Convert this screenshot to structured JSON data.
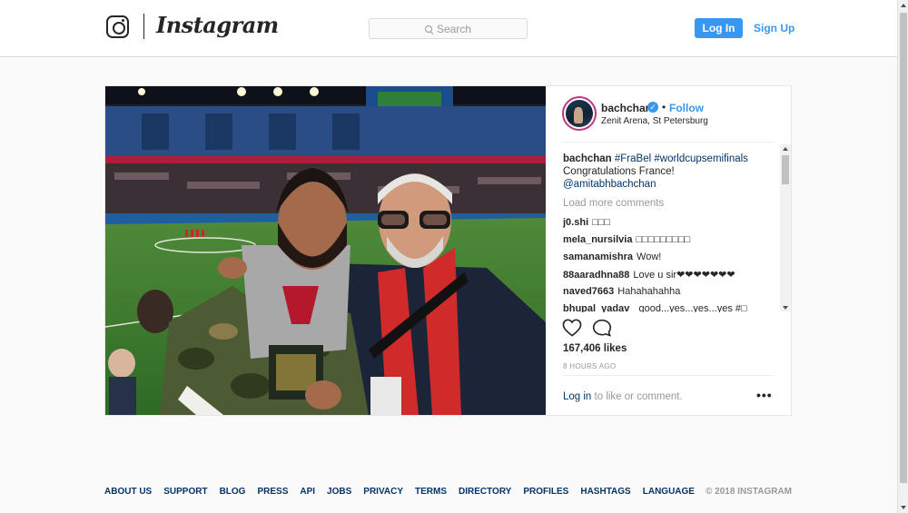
{
  "header": {
    "brand": "Instagram",
    "search_placeholder": "Search",
    "login_label": "Log In",
    "signup_label": "Sign Up",
    "icons": [
      "instagram-camera-icon",
      "search-icon"
    ]
  },
  "post": {
    "username": "bachchan",
    "verified_mark": "✓",
    "separator": "•",
    "follow_label": "Follow",
    "location": "Zenit Arena, St Petersburg",
    "caption": {
      "user": "bachchan",
      "tag1": "#FraBel",
      "tag2": "#worldcupsemifinals",
      "line2": "Congratulations France!",
      "mention": "@amitabhbachchan"
    },
    "load_more": "Load more comments",
    "comments": [
      {
        "user": "j0.shi",
        "text": "□□□"
      },
      {
        "user": "mela_nursilvia",
        "text": "□□□□□□□□□"
      },
      {
        "user": "samanamishra",
        "text": "Wow!"
      },
      {
        "user": "88aaradhna88",
        "text": "Love u sir❤❤❤❤❤❤❤"
      },
      {
        "user": "naved7663",
        "text": "Hahahahahha"
      },
      {
        "user": "bhupal_yadav_",
        "text": "good...yes...yes...yes #□"
      }
    ],
    "likes": "167,406 likes",
    "time_ago": "8 HOURS AGO",
    "login_link": "Log in",
    "login_rest": " to like or comment.",
    "more_options": "•••",
    "icons": [
      "heart-icon",
      "comment-icon",
      "verified-badge-icon",
      "more-options-icon"
    ]
  },
  "footer": {
    "links": [
      "ABOUT US",
      "SUPPORT",
      "BLOG",
      "PRESS",
      "API",
      "JOBS",
      "PRIVACY",
      "TERMS",
      "DIRECTORY",
      "PROFILES",
      "HASHTAGS",
      "LANGUAGE"
    ],
    "copyright": "© 2018 INSTAGRAM"
  },
  "colors": {
    "accent": "#3897f0",
    "link_dark": "#003569",
    "text": "#262626",
    "muted": "#999999",
    "background": "#fafafa",
    "border": "#dbdbdb"
  }
}
